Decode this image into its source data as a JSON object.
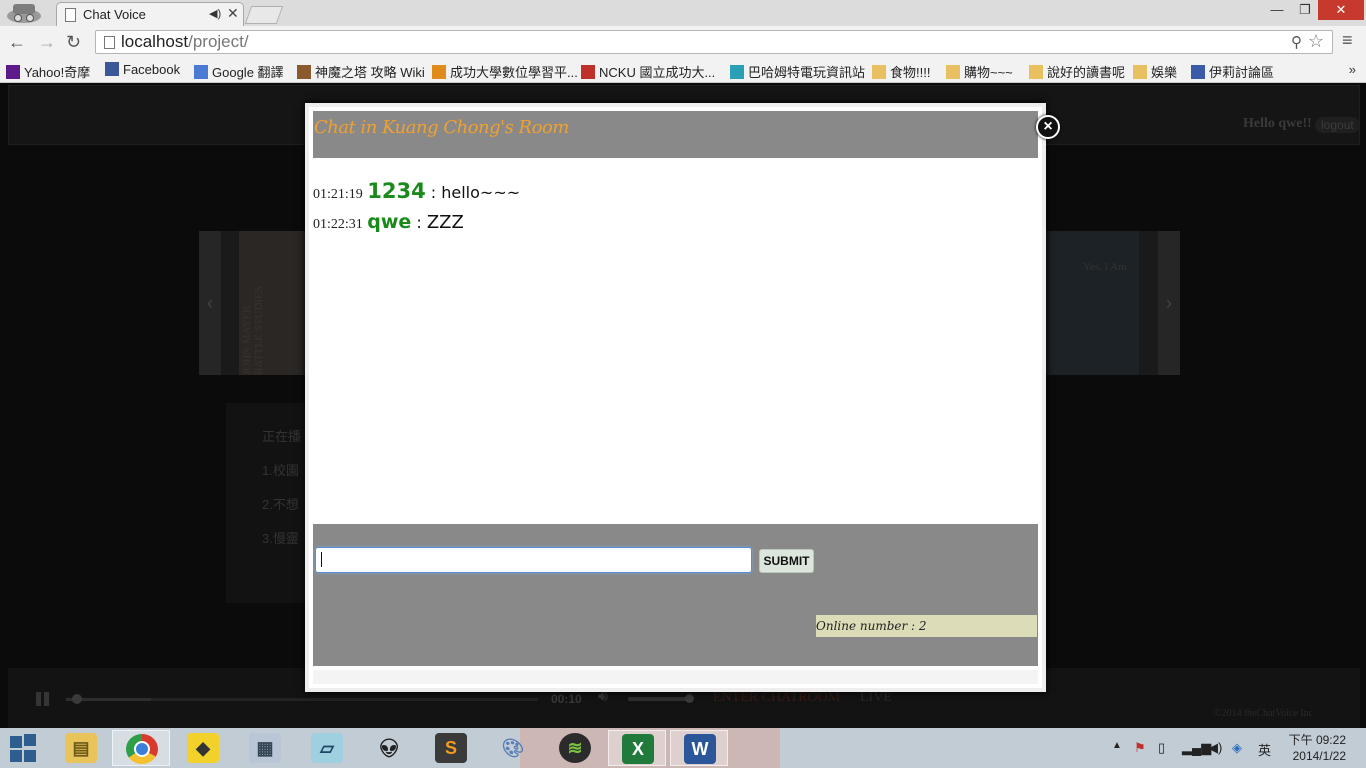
{
  "browser": {
    "tab_title": "Chat Voice",
    "tab_audio_icon": "speaker-icon",
    "tab_close": "✕",
    "url_host": "localhost",
    "url_path": "/project/",
    "bookmarks": [
      {
        "label": "Yahoo!奇摩",
        "icon": "yahoo-icon",
        "color": "#5c1a8c"
      },
      {
        "label": "Facebook",
        "icon": "facebook-icon",
        "color": "#3b5998"
      },
      {
        "label": "Google 翻譯",
        "icon": "translate-icon",
        "color": "#4b7bd4"
      },
      {
        "label": "神魔之塔 攻略 Wiki",
        "icon": "wiki-icon",
        "color": "#8a5a2c"
      },
      {
        "label": "成功大學數位學習平...",
        "icon": "moodle-icon",
        "color": "#e08b1a"
      },
      {
        "label": "NCKU 國立成功大...",
        "icon": "ncku-icon",
        "color": "#c0302a"
      },
      {
        "label": "巴哈姆特電玩資訊站",
        "icon": "bahamut-icon",
        "color": "#2aa0b8"
      },
      {
        "label": "食物!!!!",
        "icon": "folder-icon",
        "color": "#e8c060"
      },
      {
        "label": "購物~~~",
        "icon": "folder-icon",
        "color": "#e8c060"
      },
      {
        "label": "說好的讀書呢",
        "icon": "folder-icon",
        "color": "#e8c060"
      },
      {
        "label": "娛樂",
        "icon": "folder-icon",
        "color": "#e8c060"
      },
      {
        "label": "伊莉討論區",
        "icon": "eyny-icon",
        "color": "#3a5ba8"
      }
    ],
    "bookmarks_more": "»"
  },
  "page": {
    "hello": "Hello qwe!!",
    "logout": "logout",
    "album_text": "JOHN MAYER BATTLE STUDIES",
    "album_text_2": "Yes, I Am",
    "now_playing": "正在播",
    "list": [
      "1.校園",
      "2.不想",
      "3.慢靈"
    ],
    "player": {
      "time": "00:10",
      "progress": 0.18,
      "volume": 1.0,
      "enter_chatroom": "ENTER CHATROOM",
      "live": "LIVE"
    },
    "copyright": "©2014 theChatVoice Inc"
  },
  "chat": {
    "title": "Chat in Kuang Chong's Room",
    "close": "×",
    "messages": [
      {
        "time": "01:21:19",
        "user": "1234",
        "sep": " : ",
        "text": "hello~~~"
      },
      {
        "time": "01:22:31",
        "user": "qwe",
        "sep": " : ",
        "text": "ZZZ"
      }
    ],
    "input_value": "",
    "submit": "SUBMIT",
    "online": "Online number : 2"
  },
  "taskbar": {
    "apps": [
      "explorer-icon",
      "chrome-icon",
      "app-icon",
      "calculator-icon",
      "notepad-icon",
      "alien-icon",
      "sublime-icon",
      "paint-icon",
      "spotify-icon",
      "excel-icon",
      "word-icon"
    ],
    "ime": "英",
    "clock_time": "下午 09:22",
    "clock_date": "2014/1/22"
  },
  "colors": {
    "chat_title": "#f0a030",
    "username": "#1a8a1a",
    "header_bar": "#898989",
    "online_bg": "#dcdcb8",
    "close_button": "#c7392d"
  }
}
